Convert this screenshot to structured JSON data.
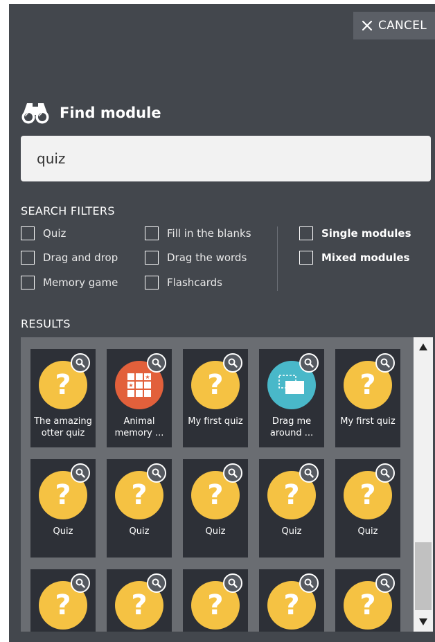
{
  "cancel": {
    "label": "CANCEL",
    "icon": "close-icon"
  },
  "find": {
    "title": "Find module",
    "icon": "binoculars-icon"
  },
  "search": {
    "value": "quiz",
    "placeholder": ""
  },
  "filters": {
    "title": "SEARCH FILTERS",
    "col1": [
      "Quiz",
      "Drag and drop",
      "Memory game"
    ],
    "col2": [
      "Fill in the blanks",
      "Drag the words",
      "Flashcards"
    ],
    "col3": [
      "Single modules",
      "Mixed modules"
    ]
  },
  "results": {
    "title": "RESULTS",
    "items": [
      {
        "label": "The amazing otter quiz",
        "type": "quiz"
      },
      {
        "label": "Animal memory ...",
        "type": "memory"
      },
      {
        "label": "My first quiz",
        "type": "quiz"
      },
      {
        "label": "Drag me around ...",
        "type": "drag"
      },
      {
        "label": "My first quiz",
        "type": "quiz"
      },
      {
        "label": "Quiz",
        "type": "quiz"
      },
      {
        "label": "Quiz",
        "type": "quiz"
      },
      {
        "label": "Quiz",
        "type": "quiz"
      },
      {
        "label": "Quiz",
        "type": "quiz"
      },
      {
        "label": "Quiz",
        "type": "quiz"
      },
      {
        "label": "",
        "type": "quiz"
      },
      {
        "label": "",
        "type": "quiz"
      },
      {
        "label": "",
        "type": "quiz"
      },
      {
        "label": "",
        "type": "quiz"
      },
      {
        "label": "",
        "type": "quiz"
      }
    ]
  },
  "colors": {
    "panel": "#43474d",
    "card": "#2d3037",
    "quiz": "#f5c243",
    "memory": "#e2603b",
    "drag": "#49b8c9"
  }
}
